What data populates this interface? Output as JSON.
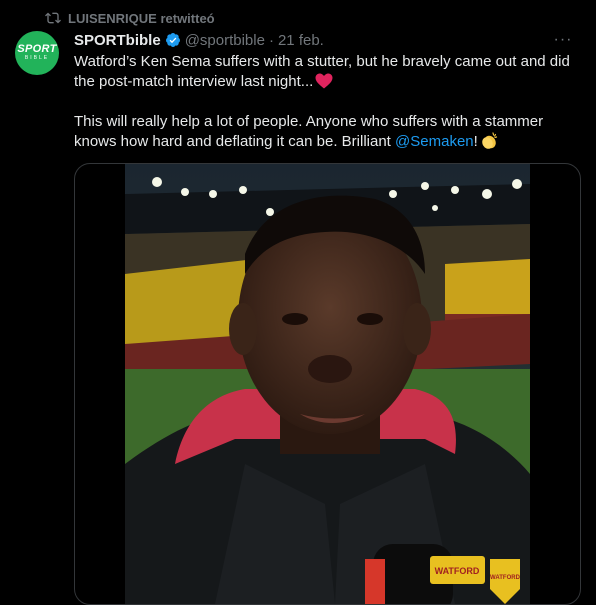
{
  "retweet": {
    "label": "LUISENRIQUE retwitteó",
    "icon": "retweet-icon"
  },
  "tweet": {
    "avatar": {
      "line1": "SPORT",
      "line2": "BIBLE"
    },
    "author_name": "SPORTbible",
    "author_handle": "@sportbible",
    "separator": "·",
    "date": "21 feb.",
    "more_label": "···",
    "paragraph1": "Watford’s Ken Sema suffers with a stutter, but he bravely came out and did the post-match interview last night...",
    "paragraph2_text": "This will really help a lot of people. Anyone who suffers with a stammer knows how hard and deflating it can be. Brilliant ",
    "mention": "@Semaken",
    "exclaim": "!",
    "icons": [
      "retweet-icon",
      "verified-badge-icon",
      "red-heart-icon",
      "clapping-hands-icon"
    ]
  },
  "media": {
    "mic_brand": "WATFORD",
    "badge_brand": "WATFORD"
  },
  "colors": {
    "background": "#000000",
    "text": "#e7e9ea",
    "muted": "#71767b",
    "link": "#1d9bf0",
    "verified": "#1d9bf0",
    "avatar": "#22b35a"
  }
}
